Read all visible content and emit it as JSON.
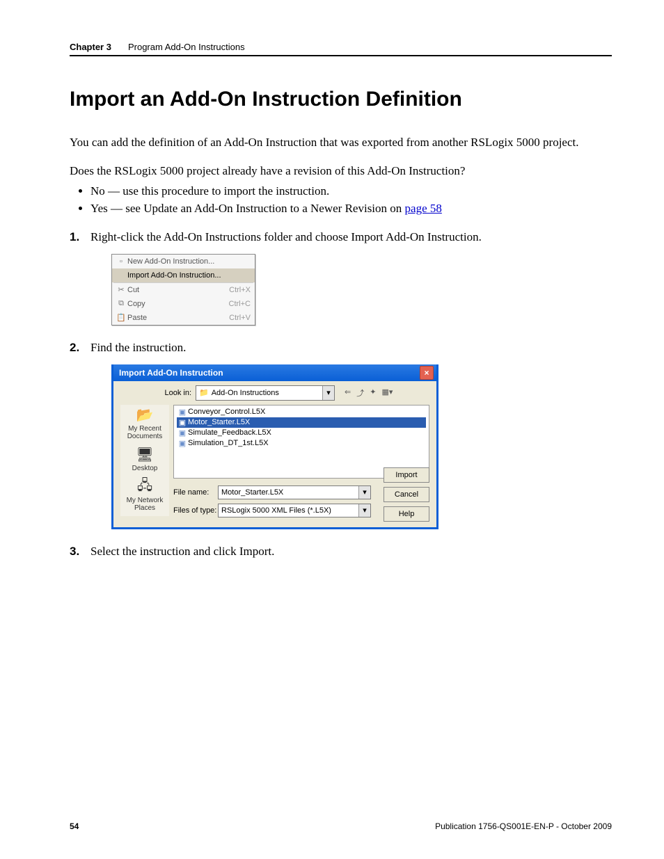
{
  "header": {
    "chapter": "Chapter 3",
    "section": "Program Add-On Instructions"
  },
  "title": "Import an Add-On Instruction Definition",
  "intro": "You can add the definition of an Add-On Instruction that was exported from another RSLogix 5000 project.",
  "question": "Does the RSLogix 5000 project already have a revision of this Add-On Instruction?",
  "bullets": {
    "no": "No — use this procedure to import the instruction.",
    "yes_prefix": "Yes — see Update an Add-On Instruction to a Newer Revision on ",
    "yes_link": "page 58"
  },
  "steps": {
    "s1_num": "1.",
    "s1_text": "Right-click the Add-On Instructions folder and choose Import Add-On Instruction.",
    "s2_num": "2.",
    "s2_text": "Find the instruction.",
    "s3_num": "3.",
    "s3_text": "Select the instruction and click Import."
  },
  "context_menu": {
    "new_aoi": "New Add-On Instruction...",
    "import_aoi": "Import Add-On Instruction...",
    "cut": "Cut",
    "cut_sc": "Ctrl+X",
    "copy": "Copy",
    "copy_sc": "Ctrl+C",
    "paste": "Paste",
    "paste_sc": "Ctrl+V"
  },
  "dialog": {
    "title": "Import Add-On Instruction",
    "lookin_label": "Look in:",
    "lookin_value": "Add-On Instructions",
    "files": {
      "f0": "Conveyor_Control.L5X",
      "f1": "Motor_Starter.L5X",
      "f2": "Simulate_Feedback.L5X",
      "f3": "Simulation_DT_1st.L5X"
    },
    "places": {
      "recent": "My Recent Documents",
      "desktop": "Desktop",
      "network": "My Network Places"
    },
    "filename_label": "File name:",
    "filename_value": "Motor_Starter.L5X",
    "filetype_label": "Files of type:",
    "filetype_value": "RSLogix 5000 XML Files (*.L5X)",
    "btn_import": "Import",
    "btn_cancel": "Cancel",
    "btn_help": "Help"
  },
  "footer": {
    "page": "54",
    "pub": "Publication 1756-QS001E-EN-P - October 2009"
  }
}
